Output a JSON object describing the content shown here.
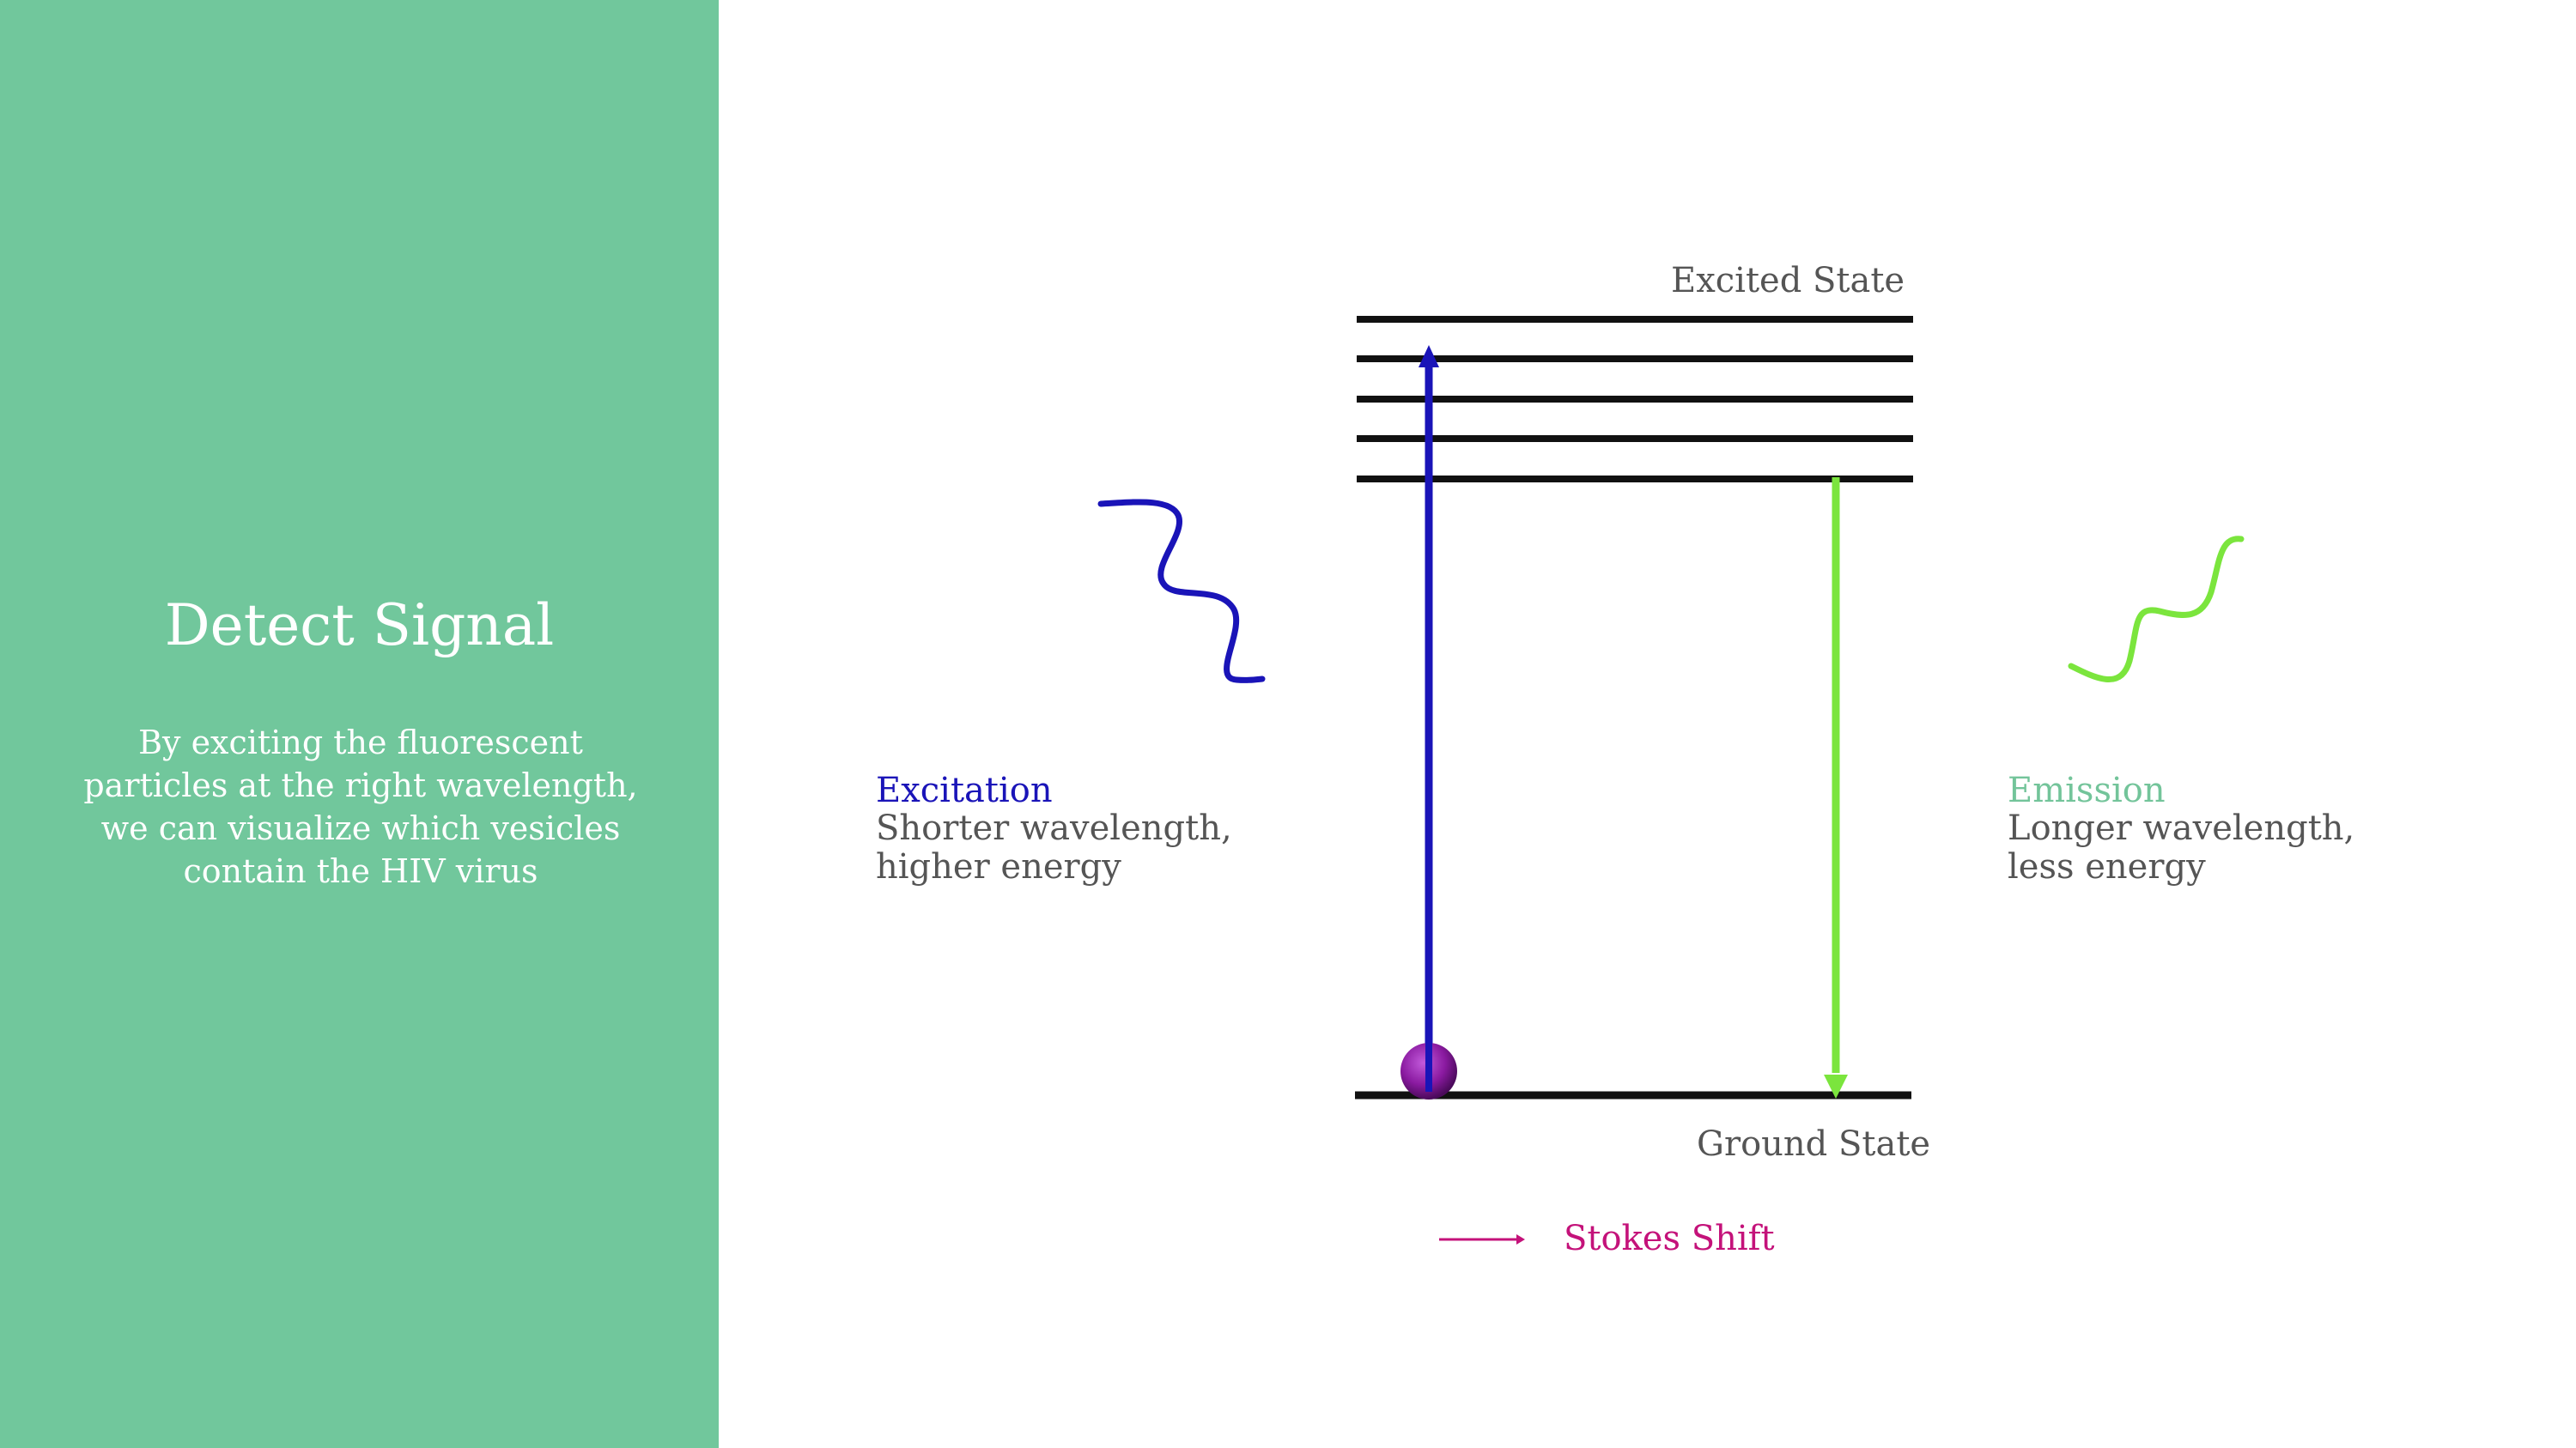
{
  "colors": {
    "panel": "#71c79c",
    "excitation": "#1a14b8",
    "emission": "#7be53d",
    "emission_label": "#73c49a",
    "stokes": "#c4127a",
    "levels": "#111111",
    "electron": "#8a1aa0"
  },
  "sidebar": {
    "title": "Detect Signal",
    "body": "By exciting the fluorescent particles at the right wavelength, we can visualize which vesicles contain the HIV virus"
  },
  "diagram": {
    "excited_label": "Excited State",
    "ground_label": "Ground State",
    "excitation": {
      "heading": "Excitation",
      "description": "Shorter wavelength, higher energy",
      "wave_icon": "wavy-line-icon"
    },
    "emission": {
      "heading": "Emission",
      "description": "Longer  wavelength, less energy",
      "wave_icon": "wavy-line-icon"
    },
    "legend": {
      "label": "Stokes Shift",
      "icon": "arrow-right-icon"
    },
    "electron_icon": "sphere-icon"
  }
}
